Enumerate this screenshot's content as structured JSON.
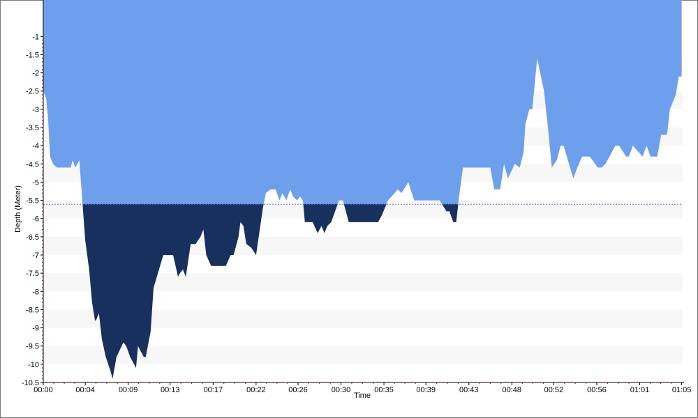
{
  "colors": {
    "surface": "#6e9fec",
    "deep": "#17305e",
    "band": "#f7f7f7",
    "avg_line": "#6b6bd6",
    "axis": "#000000",
    "minor_tick": "#cc0000"
  },
  "chart_data": {
    "type": "area",
    "title": "",
    "xlabel": "Time",
    "ylabel": "Depth (Meter)",
    "ylim": [
      -10.5,
      0
    ],
    "xlim": [
      0,
      65.5
    ],
    "yticks": [
      -1,
      -1.5,
      -2,
      -2.5,
      -3,
      -3.5,
      -4,
      -4.5,
      -5,
      -5.5,
      -6,
      -6.5,
      -7,
      -7.5,
      -8,
      -8.5,
      -9,
      -9.5,
      -10,
      -10.5
    ],
    "ytick_labels": [
      "-1",
      "-1.5",
      "-2",
      "-2.5",
      "-3",
      "-3.5",
      "-4",
      "-4.5",
      "-5",
      "-5.5",
      "-6",
      "-6.5",
      "-7",
      "-7.5",
      "-8",
      "-8.5",
      "-9",
      "-9.5",
      "-10",
      "-10.5"
    ],
    "xticks": [
      0,
      4.3,
      8.7,
      13,
      17.4,
      21.8,
      26.1,
      30.5,
      34.9,
      39.2,
      43.6,
      48,
      52.3,
      56.7,
      61.1,
      65.4
    ],
    "xtick_labels": [
      "00:00",
      "00:04",
      "00:09",
      "00:13",
      "00:17",
      "00:22",
      "00:26",
      "00:30",
      "00:35",
      "00:39",
      "00:43",
      "00:48",
      "00:52",
      "00:56",
      "01:01",
      "01:05"
    ],
    "threshold_depth": -5.6,
    "grid": "horizontal alternating bands",
    "x": [
      0,
      0.3,
      0.5,
      0.7,
      1.0,
      1.4,
      2.0,
      2.8,
      3.0,
      3.3,
      3.5,
      3.7,
      4.0,
      4.3,
      4.7,
      5.0,
      5.3,
      5.4,
      5.7,
      6.0,
      6.4,
      6.9,
      7.1,
      7.5,
      8.2,
      8.5,
      8.9,
      9.3,
      9.5,
      9.7,
      10.3,
      10.5,
      11.0,
      11.3,
      12.3,
      13.3,
      13.8,
      14.0,
      14.3,
      14.6,
      15.1,
      15.6,
      16.1,
      16.4,
      16.7,
      17.2,
      18.7,
      19.2,
      19.5,
      20.0,
      20.2,
      20.5,
      20.8,
      21.3,
      21.8,
      22.5,
      22.8,
      23.3,
      23.8,
      24.2,
      24.5,
      24.9,
      25.3,
      25.6,
      26.0,
      26.3,
      26.6,
      26.8,
      27.6,
      28.1,
      28.5,
      28.8,
      29.1,
      29.5,
      30.3,
      30.7,
      31.1,
      31.3,
      32.0,
      34.3,
      34.7,
      35.3,
      36.0,
      36.3,
      36.7,
      37.4,
      38.0,
      38.6,
      39.4,
      40.6,
      41.3,
      41.6,
      42.0,
      42.3,
      42.6,
      43.0,
      44.6,
      45.8,
      46.2,
      46.8,
      47.2,
      47.6,
      48.3,
      48.8,
      49.2,
      49.4,
      49.8,
      50.1,
      50.6,
      51.3,
      51.7,
      52.1,
      52.6,
      53.0,
      53.3,
      54.3,
      54.7,
      55.2,
      56.0,
      56.8,
      57.2,
      57.6,
      58.6,
      59.0,
      59.7,
      60.0,
      60.4,
      61.4,
      61.8,
      62.2,
      62.9,
      63.3,
      63.9,
      64.2,
      64.8,
      65.1,
      65.4
    ],
    "values": [
      -2.5,
      -2.7,
      -3.3,
      -4.3,
      -4.5,
      -4.6,
      -4.6,
      -4.6,
      -4.4,
      -4.6,
      -4.5,
      -4.4,
      -5.5,
      -6.6,
      -7.4,
      -8.3,
      -8.8,
      -8.8,
      -8.6,
      -9.3,
      -9.8,
      -10.2,
      -10.4,
      -9.8,
      -9.4,
      -9.5,
      -9.8,
      -10.0,
      -10.1,
      -9.5,
      -9.8,
      -9.8,
      -9.1,
      -7.9,
      -7.0,
      -7.0,
      -7.6,
      -7.5,
      -7.4,
      -7.6,
      -6.7,
      -6.7,
      -6.5,
      -6.3,
      -7.0,
      -7.3,
      -7.3,
      -7.0,
      -7.0,
      -6.5,
      -6.1,
      -6.2,
      -6.7,
      -6.8,
      -7.0,
      -5.7,
      -5.3,
      -5.2,
      -5.2,
      -5.5,
      -5.3,
      -5.5,
      -5.2,
      -5.4,
      -5.5,
      -5.4,
      -5.5,
      -6.1,
      -6.1,
      -6.4,
      -6.2,
      -6.4,
      -6.2,
      -6.1,
      -5.5,
      -5.5,
      -5.9,
      -6.1,
      -6.1,
      -6.1,
      -5.9,
      -5.5,
      -5.3,
      -5.2,
      -5.3,
      -5.0,
      -5.5,
      -5.5,
      -5.5,
      -5.5,
      -5.8,
      -5.8,
      -6.1,
      -6.1,
      -5.4,
      -4.6,
      -4.6,
      -4.6,
      -5.2,
      -5.2,
      -4.5,
      -4.9,
      -4.5,
      -4.6,
      -4.2,
      -3.4,
      -3.0,
      -3.0,
      -1.6,
      -2.5,
      -3.5,
      -4.6,
      -4.4,
      -4.0,
      -4.0,
      -4.9,
      -4.6,
      -4.3,
      -4.3,
      -4.6,
      -4.6,
      -4.5,
      -4.0,
      -4.0,
      -4.3,
      -4.3,
      -4.0,
      -4.3,
      -4.0,
      -4.3,
      -4.3,
      -3.7,
      -3.7,
      -3.0,
      -2.6,
      -2.1,
      -2.1
    ]
  }
}
